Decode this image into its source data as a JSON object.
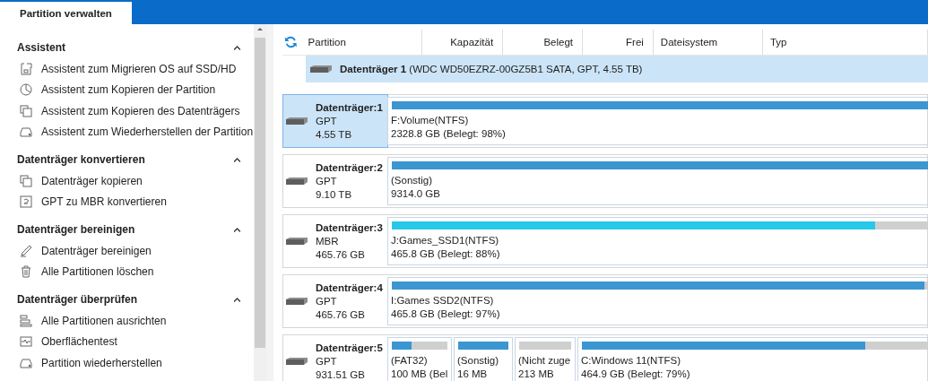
{
  "tabs": [
    {
      "label": "Partition verwalten",
      "selected": true
    }
  ],
  "sidebar": {
    "sections": [
      {
        "title": "Assistent",
        "expanded": true,
        "items": [
          "Assistent zum Migrieren OS auf SSD/HD",
          "Assistent zum Kopieren der Partition",
          "Assistent zum Kopieren des Datenträgers",
          "Assistent zum Wiederherstellen der Partition"
        ]
      },
      {
        "title": "Datenträger konvertieren",
        "expanded": true,
        "items": [
          "Datenträger kopieren",
          "GPT zu MBR konvertieren"
        ]
      },
      {
        "title": "Datenträger bereinigen",
        "expanded": true,
        "items": [
          "Datenträger bereinigen",
          "Alle Partitionen löschen"
        ]
      },
      {
        "title": "Datenträger überprüfen",
        "expanded": true,
        "items": [
          "Alle Partitionen ausrichten",
          "Oberflächentest",
          "Partition wiederherstellen"
        ]
      }
    ]
  },
  "table": {
    "columns": [
      "Partition",
      "Kapazität",
      "Belegt",
      "Frei",
      "Dateisystem",
      "Typ"
    ],
    "disk_row": {
      "name": "Datenträger 1",
      "detail": "(WDC WD50EZRZ-00GZ5B1 SATA, GPT, 4.55 TB)",
      "selected": true
    }
  },
  "disks": [
    {
      "name": "Datenträger:1",
      "style": "GPT",
      "size": "4.55 TB",
      "selected": true,
      "partitions": [
        {
          "label": "F:Volume(NTFS)",
          "info": "2328.8 GB (Belegt: 98%)",
          "level": 0.98,
          "color": "#3b96d2"
        }
      ]
    },
    {
      "name": "Datenträger:2",
      "style": "GPT",
      "size": "9.10 TB",
      "selected": false,
      "partitions": [
        {
          "label": "(Sonstig)",
          "info": "9314.0 GB",
          "level": 1,
          "color": "#3b96d2"
        }
      ]
    },
    {
      "name": "Datenträger:3",
      "style": "MBR",
      "size": "465.76 GB",
      "selected": false,
      "partitions": [
        {
          "label": "J:Games_SSD1(NTFS)",
          "info": "465.8 GB (Belegt: 88%)",
          "level": 0.88,
          "color": "#27c8e8"
        }
      ]
    },
    {
      "name": "Datenträger:4",
      "style": "GPT",
      "size": "465.76 GB",
      "selected": false,
      "partitions": [
        {
          "label": "I:Games SSD2(NTFS)",
          "info": "465.8 GB (Belegt: 97%)",
          "level": 0.97,
          "color": "#3b96d2"
        }
      ]
    },
    {
      "name": "Datenträger:5",
      "style": "GPT",
      "size": "931.51 GB",
      "selected": false,
      "partitions": [
        {
          "label": "(FAT32)",
          "info": "100 MB (Bel",
          "level": 0.35,
          "color": "#3b96d2"
        },
        {
          "label": "(Sonstig)",
          "info": "16 MB",
          "level": 1,
          "color": "#3b96d2"
        },
        {
          "kind": "unallocated",
          "label": "(Nicht zuge",
          "info": "213 MB"
        },
        {
          "label": "C:Windows 11(NTFS)",
          "info": "464.9 GB (Belegt: 79%)",
          "level": 0.79,
          "color": "#3b96d2"
        }
      ]
    }
  ]
}
